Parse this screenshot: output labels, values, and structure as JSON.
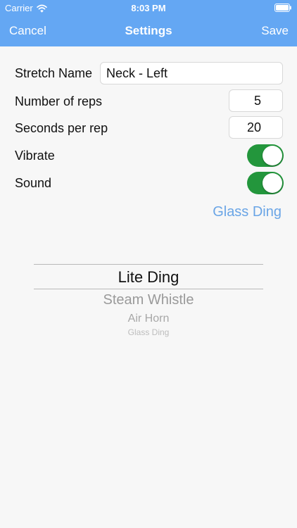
{
  "status_bar": {
    "carrier": "Carrier",
    "time": "8:03 PM"
  },
  "nav": {
    "left_label": "Cancel",
    "title": "Settings",
    "right_label": "Save"
  },
  "form": {
    "stretch_name": {
      "label": "Stretch Name",
      "value": "Neck - Left"
    },
    "reps": {
      "label": "Number of reps",
      "value": "5"
    },
    "seconds": {
      "label": "Seconds per rep",
      "value": "20"
    },
    "vibrate": {
      "label": "Vibrate",
      "on": true
    },
    "sound": {
      "label": "Sound",
      "on": true
    },
    "sound_name": "Glass Ding"
  },
  "picker": {
    "items": [
      "Lite Ding",
      "Steam Whistle",
      "Air Horn",
      "Glass Ding"
    ]
  },
  "colors": {
    "header_blue": "#64a7f3",
    "toggle_green": "#23963c",
    "link_blue": "#6aa5e6"
  },
  "icons": {
    "wifi": "wifi-icon",
    "battery": "battery-icon"
  }
}
